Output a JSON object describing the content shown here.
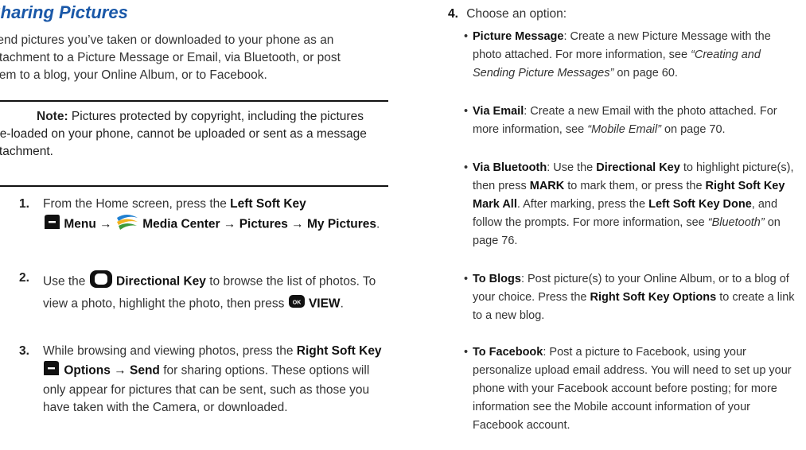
{
  "left": {
    "title": "Sharing Pictures",
    "intro": "Send pictures you’ve taken or downloaded to your phone as an attachment to a Picture Message or Email, via Bluetooth, or post them to a blog, your Online Album, or to Facebook.",
    "note_label": "Note:",
    "note_text": "Pictures protected by copyright, including the pictures pre-loaded on your phone, cannot be uploaded or sent as a message attachment.",
    "step1": {
      "num": "1.",
      "a": "From the Home screen, press the ",
      "b1": "Left Soft Key",
      "b2": "Menu",
      "arrow1": "→",
      "b3": "Media Center",
      "arrow2": "→",
      "b4": "Pictures",
      "arrow3": "→",
      "b5": "My Pictures",
      "end": "."
    },
    "step2": {
      "num": "2.",
      "a": "Use the",
      "b1": "Directional Key",
      "c": "to browse the list of photos. To view a photo, highlight the photo, then press",
      "b2": "VIEW",
      "end": ".",
      "ok_label": "OK"
    },
    "step3": {
      "num": "3.",
      "a": "While browsing and viewing photos, press the ",
      "b1": "Right Soft Key",
      "b2": "Options",
      "arrow": "→",
      "b3": "Send",
      "c": " for sharing options. These options will only appear for pictures that can be sent, such as those you have taken with the Camera, or downloaded."
    }
  },
  "right": {
    "step4_num": "4.",
    "step4_text": "Choose an option:",
    "bullets": [
      {
        "label": "Picture Message",
        "text": ": Create a new Picture Message with the photo attached. For more information, see ",
        "ref": "“Creating and Sending Picture Messages”",
        "page": " on page 60."
      },
      {
        "label": "Via Email",
        "text": ": Create a new Email with the photo attached. For more information, see ",
        "ref": "“Mobile Email”",
        "page": " on page 70."
      },
      {
        "label": "Via Bluetooth",
        "text1": ": Use the ",
        "b1": "Directional Key",
        "text2": " to highlight picture(s), then press ",
        "b2": "MARK",
        "text3": " to mark them, or press the ",
        "b3": "Right Soft Key Mark All",
        "text4": ". After marking, press the ",
        "b4": "Left Soft Key Done",
        "text5": ", and follow the prompts. For more information, see ",
        "ref": "“Bluetooth”",
        "page": " on page 76."
      },
      {
        "label": "To Blogs",
        "text1": ": Post picture(s) to your Online Album, or to a blog of your choice. Press the ",
        "b1": "Right Soft Key Options",
        "text2": " to create a link to a new blog."
      },
      {
        "label": "To Facebook",
        "text": ": Post a picture to Facebook, using your personalize upload email address. You will need to set up your phone with your Facebook account before posting; for more information see the Mobile account information of your Facebook account."
      }
    ]
  },
  "colors": {
    "title": "#1a58a8",
    "text": "#333333",
    "rule": "#111111"
  },
  "icons": [
    "left-soft-key-icon",
    "media-center-icon",
    "directional-key-icon",
    "ok-key-icon",
    "right-soft-key-icon"
  ]
}
